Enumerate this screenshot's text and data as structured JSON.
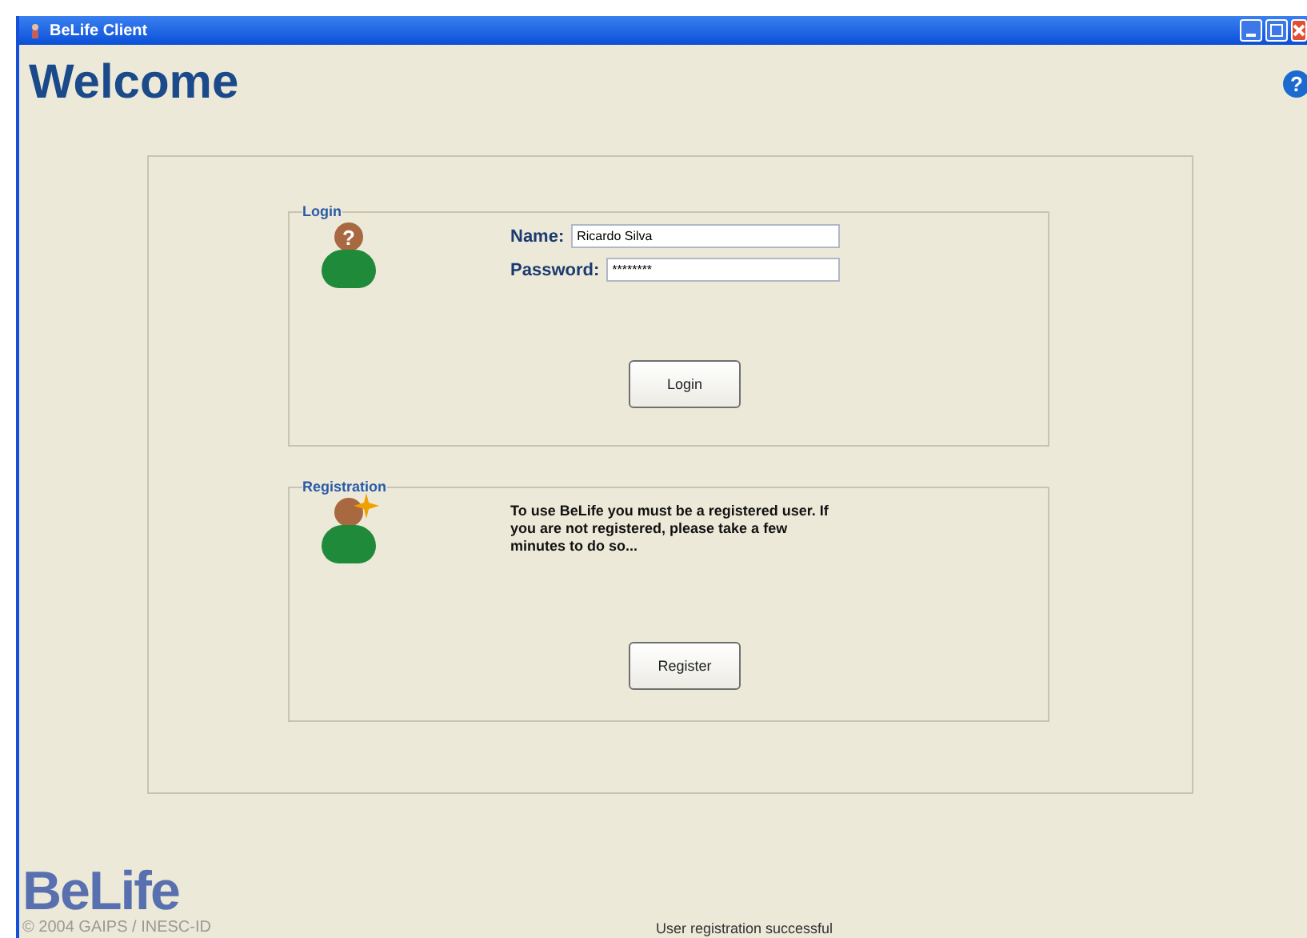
{
  "window": {
    "title": "BeLife Client"
  },
  "header": {
    "title": "Welcome",
    "help": "?"
  },
  "login": {
    "legend": "Login",
    "avatar_mark": "?",
    "fields": [
      {
        "label": "Name:",
        "value": "Ricardo Silva"
      },
      {
        "label": "Password:",
        "value": "********"
      }
    ],
    "button": "Login"
  },
  "registration": {
    "legend": "Registration",
    "message": "To use BeLife you must be a registered user. If you are not registered, please take a few minutes to do so...",
    "button": "Register"
  },
  "footer": {
    "logo": "BeLife",
    "copyright": "© 2004 GAIPS / INESC-ID",
    "status": "User registration successful"
  }
}
